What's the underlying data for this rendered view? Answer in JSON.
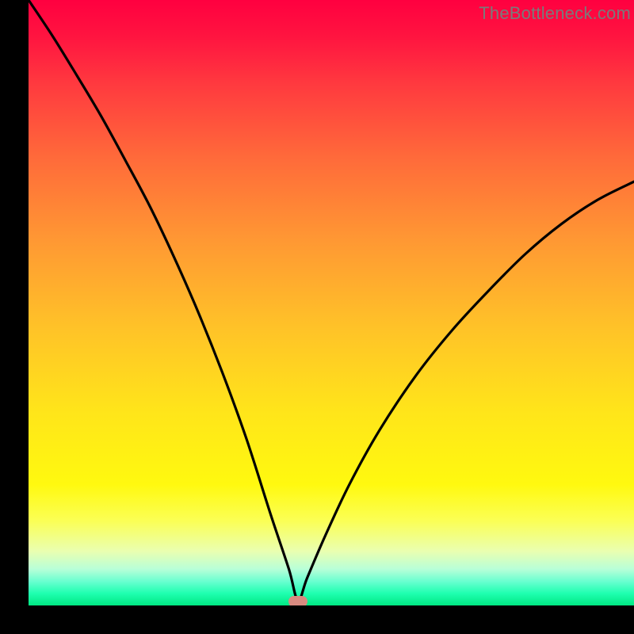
{
  "attribution": "TheBottleneck.com",
  "marker": {
    "x_frac": 0.445,
    "y_frac": 0.994,
    "color": "#d88a80"
  },
  "chart_data": {
    "type": "line",
    "title": "",
    "xlabel": "",
    "ylabel": "",
    "xlim": [
      0,
      1
    ],
    "ylim": [
      0,
      1
    ],
    "note": "Axes are hidden; fractions are relative to the colored plot area. y=1 is the top (red), y=0 is the bottom (green). Marker sits at the curve minimum.",
    "series": [
      {
        "name": "bottleneck-curve",
        "x": [
          0.0,
          0.04,
          0.08,
          0.12,
          0.16,
          0.2,
          0.24,
          0.28,
          0.32,
          0.36,
          0.4,
          0.43,
          0.445,
          0.46,
          0.49,
          0.53,
          0.58,
          0.64,
          0.7,
          0.76,
          0.82,
          0.88,
          0.94,
          1.0
        ],
        "y": [
          1.0,
          0.94,
          0.875,
          0.808,
          0.735,
          0.66,
          0.576,
          0.485,
          0.385,
          0.275,
          0.15,
          0.06,
          0.008,
          0.045,
          0.115,
          0.2,
          0.29,
          0.38,
          0.455,
          0.52,
          0.58,
          0.63,
          0.67,
          0.7
        ]
      }
    ]
  }
}
